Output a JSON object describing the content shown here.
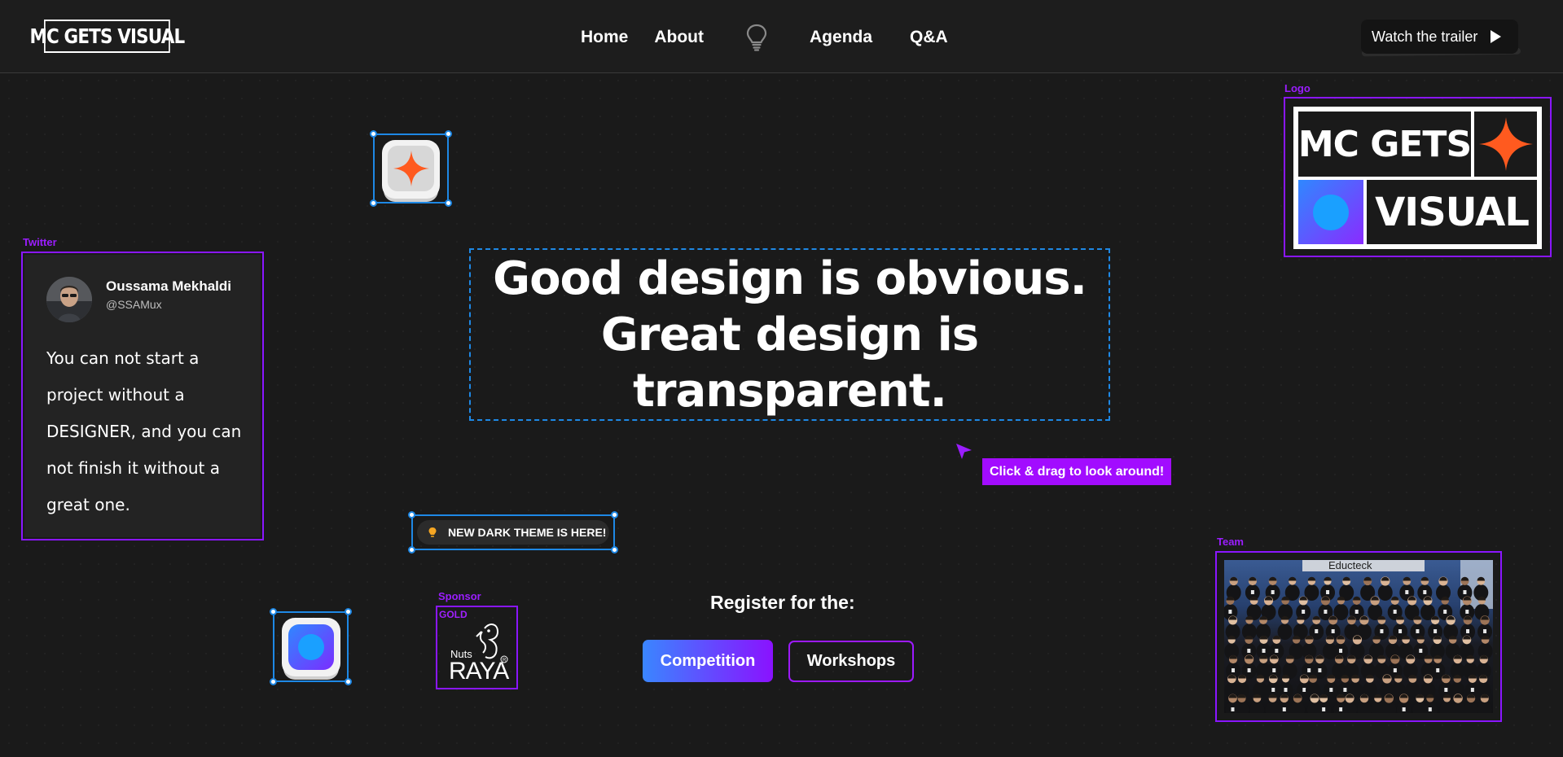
{
  "nav": {
    "brand": "MC GETS VISUAL",
    "links": [
      "Home",
      "About",
      "Agenda",
      "Q&A"
    ],
    "theme_icon": "lightbulb-icon",
    "trailer_label": "Watch the trailer",
    "trailer_icon": "play-icon"
  },
  "canvas": {
    "headline": "Good design is obvious. Great design is transparent.",
    "drag_hint": "Click & drag to look around!",
    "theme_pill": "NEW DARK THEME IS HERE!"
  },
  "twitter": {
    "label": "Twitter",
    "name": "Oussama Mekhaldi",
    "handle": "@SSAMux",
    "text": "You can not start a project without a DESIGNER, and you can not finish it without a great one."
  },
  "sponsor": {
    "label": "Sponsor",
    "tier": "GOLD",
    "logo_text_small": "Nuts",
    "logo_text_big": "RAYA"
  },
  "register": {
    "heading": "Register for the:",
    "competition": "Competition",
    "workshops": "Workshops"
  },
  "logo_panel": {
    "label": "Logo",
    "line1": "MC GETS",
    "line2": "VISUAL"
  },
  "team": {
    "label": "Team",
    "banner_text": "Educteck"
  },
  "colors": {
    "accent_purple": "#8a16ff",
    "selection_blue": "#1e88e5",
    "star_orange": "#ff5a1f",
    "background": "#1a1a1a"
  }
}
